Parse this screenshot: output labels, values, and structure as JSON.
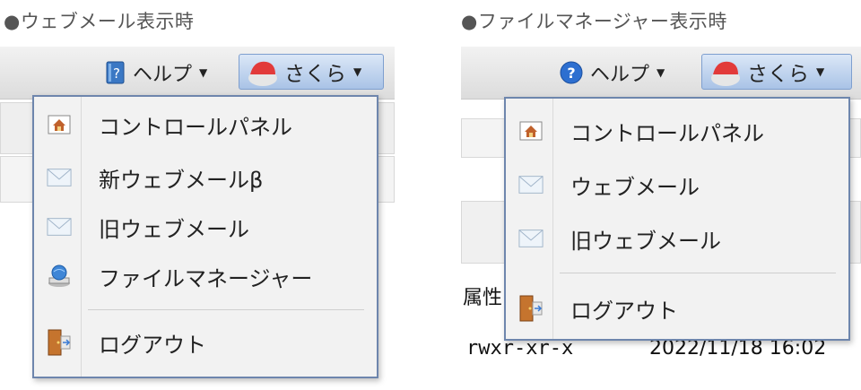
{
  "left": {
    "caption": "●ウェブメール表示時",
    "help_label": "ヘルプ",
    "user_label": "さくら",
    "menu": [
      {
        "icon": "home-icon",
        "label": "コントロールパネル"
      },
      {
        "icon": "mail-icon",
        "label": "新ウェブメールβ"
      },
      {
        "icon": "mail-icon",
        "label": "旧ウェブメール"
      },
      {
        "icon": "file-manager-icon",
        "label": "ファイルマネージャー"
      },
      {
        "icon": "logout-door-icon",
        "label": "ログアウト"
      }
    ]
  },
  "right": {
    "caption": "●ファイルマネージャー表示時",
    "help_label": "ヘルプ",
    "user_label": "さくら",
    "menu": [
      {
        "icon": "home-icon",
        "label": "コントロールパネル"
      },
      {
        "icon": "mail-icon",
        "label": "ウェブメール"
      },
      {
        "icon": "mail-icon",
        "label": "旧ウェブメール"
      },
      {
        "icon": "logout-door-icon",
        "label": "ログアウト"
      }
    ],
    "background": {
      "attr_header": "属性",
      "perm_value": "rwxr-xr-x",
      "date_value": "2022/11/18 16:02"
    }
  }
}
